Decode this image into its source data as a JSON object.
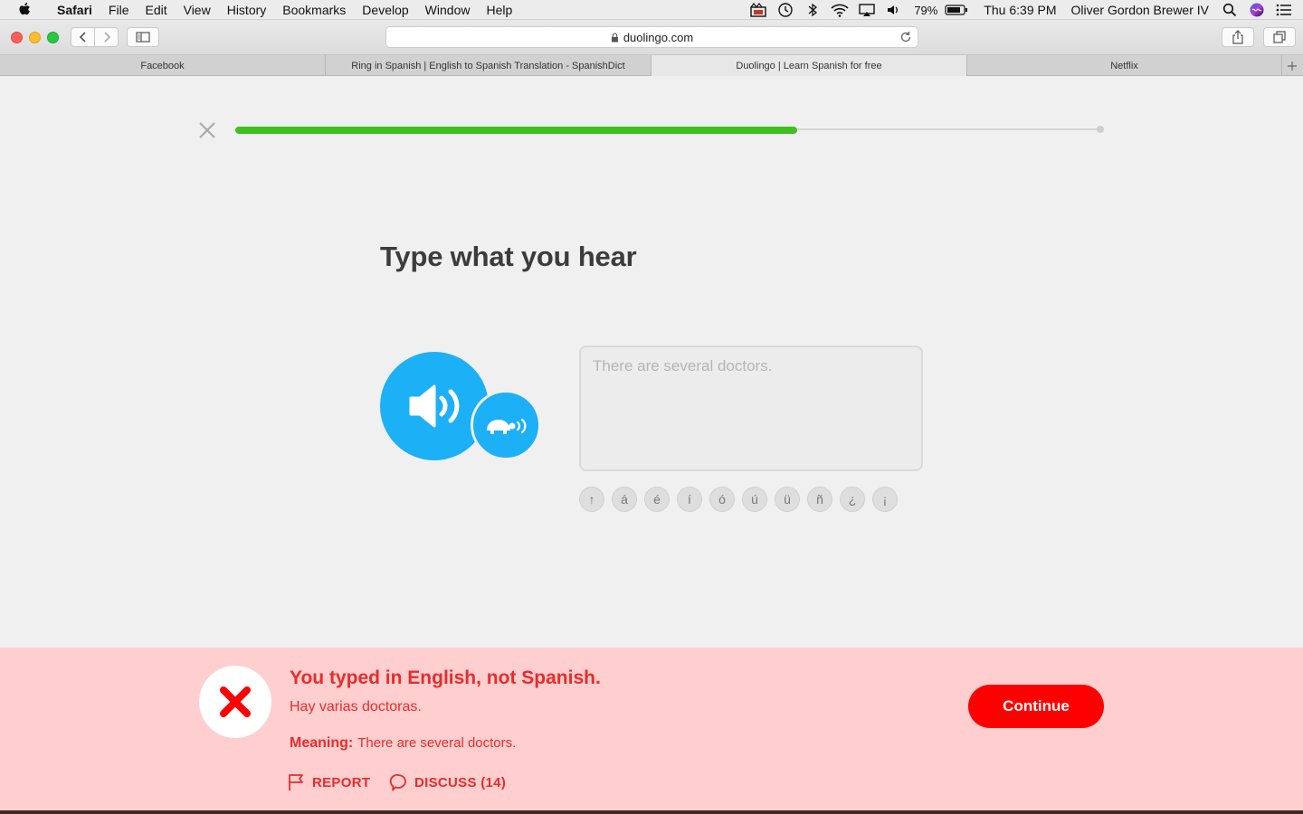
{
  "menubar": {
    "app_name": "Safari",
    "items": [
      "File",
      "Edit",
      "View",
      "History",
      "Bookmarks",
      "Develop",
      "Window",
      "Help"
    ],
    "battery_percent": "79%",
    "clock": "Thu 6:39 PM",
    "user_name": "Oliver Gordon Brewer IV"
  },
  "browser": {
    "address": "duolingo.com",
    "tabs": [
      {
        "label": "Facebook",
        "active": false
      },
      {
        "label": "Ring in Spanish | English to Spanish Translation - SpanishDict",
        "active": false
      },
      {
        "label": "Duolingo | Learn Spanish for free",
        "active": true
      },
      {
        "label": "Netflix",
        "active": false
      }
    ]
  },
  "lesson": {
    "progress": 0.65,
    "progress_color": "#3ec11f",
    "prompt": "Type what you hear",
    "answer_text": "There are several doctors.",
    "special_chars": [
      "↑",
      "á",
      "é",
      "í",
      "ó",
      "ú",
      "ü",
      "ñ",
      "¿",
      "¡"
    ],
    "accent_color": "#1cb0f6"
  },
  "feedback": {
    "title": "You typed in English, not Spanish.",
    "correct_answer": "Hay varias doctoras.",
    "meaning_label": "Meaning:",
    "meaning_text": "There are several doctors.",
    "report_label": "REPORT",
    "discuss_label": "DISCUSS (14)",
    "continue_label": "Continue",
    "error_color": "#ea2b2b"
  }
}
